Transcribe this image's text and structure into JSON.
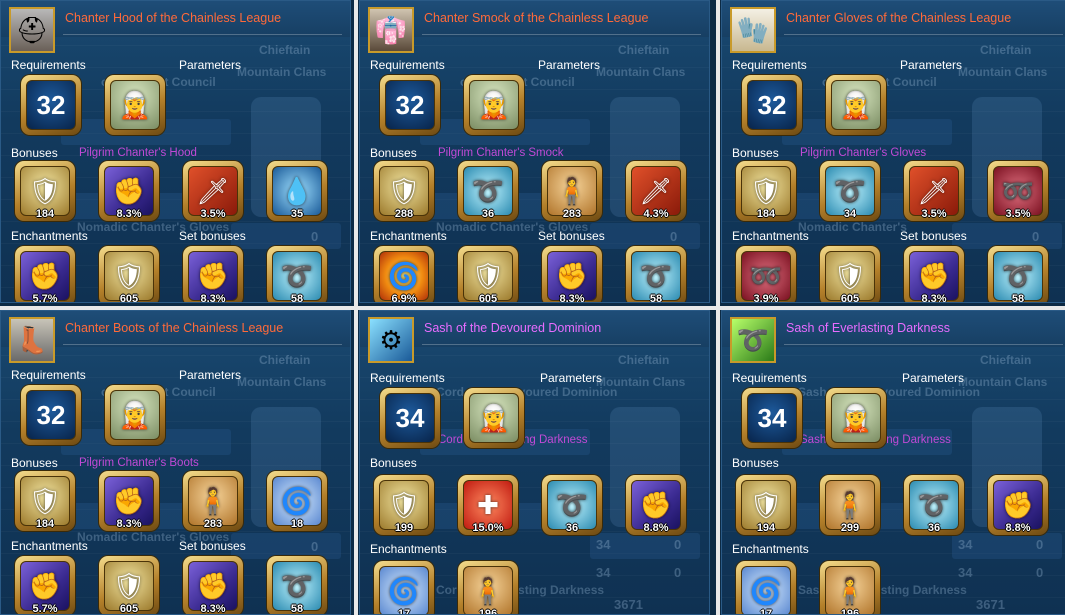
{
  "labels": {
    "requirements": "Requirements",
    "parameters": "Parameters",
    "bonuses": "Bonuses",
    "enchantments": "Enchantments",
    "set_bonuses": "Set bonuses"
  },
  "background": {
    "clan": "Mountain Clans",
    "chieftain": "Chieftain",
    "total": "3671",
    "count_34": "34",
    "count_0": "0"
  },
  "panels": [
    {
      "title": "Chanter Hood of the Chainless League",
      "title_color": "#ff6a3a",
      "item_icon": "hood-icon",
      "ghost_top": "of the Great Council",
      "subtitle": "Pilgrim Chanter's Hood",
      "ghost_mid": "Nomadic Chanter's Gloves",
      "level": "32",
      "bonuses": [
        {
          "icon": "hp-shield-icon",
          "value": "184"
        },
        {
          "icon": "crit-gauntlet-icon",
          "value": "8.3%"
        },
        {
          "icon": "attack-sword-icon",
          "value": "3.5%"
        },
        {
          "icon": "water-drop-icon",
          "value": "35"
        }
      ],
      "enchantments": [
        {
          "icon": "crit-gauntlet-icon",
          "value": "5.7%"
        },
        {
          "icon": "hp-shield-icon",
          "value": "605"
        },
        {
          "icon": "crit-gauntlet-icon",
          "value": "8.3%"
        },
        {
          "icon": "staff-icon",
          "value": "58"
        }
      ]
    },
    {
      "title": "Chanter Smock of the Chainless League",
      "title_color": "#ff6a3a",
      "item_icon": "smock-icon",
      "ghost_top": "of the Great Council",
      "subtitle": "Pilgrim Chanter's Smock",
      "ghost_mid": "Nomadic Chanter's Gloves",
      "level": "32",
      "bonuses": [
        {
          "icon": "hp-shield-icon",
          "value": "288"
        },
        {
          "icon": "staff-icon",
          "value": "36"
        },
        {
          "icon": "body-icon",
          "value": "283"
        },
        {
          "icon": "attack-sword-icon",
          "value": "4.3%"
        }
      ],
      "enchantments": [
        {
          "icon": "fire-swirl-icon",
          "value": "6.9%"
        },
        {
          "icon": "hp-shield-icon",
          "value": "605"
        },
        {
          "icon": "crit-gauntlet-icon",
          "value": "8.3%"
        },
        {
          "icon": "staff-icon",
          "value": "58"
        }
      ]
    },
    {
      "title": "Chanter Gloves of the Chainless League",
      "title_color": "#ff6a3a",
      "item_icon": "gloves-icon",
      "ghost_top": "of the Great Council",
      "subtitle": "Pilgrim Chanter's Gloves",
      "ghost_mid": "Nomadic Chanter's",
      "level": "32",
      "bonuses": [
        {
          "icon": "hp-shield-icon",
          "value": "184"
        },
        {
          "icon": "staff-icon",
          "value": "34"
        },
        {
          "icon": "attack-sword-icon",
          "value": "3.5%"
        },
        {
          "icon": "pink-hook-icon",
          "value": "3.5%"
        }
      ],
      "enchantments": [
        {
          "icon": "pink-hook-icon",
          "value": "3.9%"
        },
        {
          "icon": "hp-shield-icon",
          "value": "605"
        },
        {
          "icon": "crit-gauntlet-icon",
          "value": "8.3%"
        },
        {
          "icon": "staff-icon",
          "value": "58"
        }
      ]
    },
    {
      "title": "Chanter Boots of the Chainless League",
      "title_color": "#ff6a3a",
      "item_icon": "boots-icon",
      "ghost_top": "of the Great Council",
      "subtitle": "Pilgrim Chanter's Boots",
      "ghost_mid": "Nomadic Chanter's Gloves",
      "level": "32",
      "bonuses": [
        {
          "icon": "hp-shield-icon",
          "value": "184"
        },
        {
          "icon": "crit-gauntlet-icon",
          "value": "8.3%"
        },
        {
          "icon": "body-icon",
          "value": "283"
        },
        {
          "icon": "spiral-icon",
          "value": "18"
        }
      ],
      "enchantments": [
        {
          "icon": "crit-gauntlet-icon",
          "value": "5.7%"
        },
        {
          "icon": "hp-shield-icon",
          "value": "605"
        },
        {
          "icon": "crit-gauntlet-icon",
          "value": "8.3%"
        },
        {
          "icon": "staff-icon",
          "value": "58"
        }
      ]
    },
    {
      "title": "Sash of the Devoured Dominion",
      "title_color": "#e86cff",
      "item_icon": "sash-blue-icon",
      "ghost_top": "Cord of the Devoured Dominion",
      "subtitle": "Cord of Everlasting Darkness",
      "ghost_mid": "Cord of Everlasting Darkness",
      "level": "34",
      "bonuses": [
        {
          "icon": "hp-shield-icon",
          "value": "199"
        },
        {
          "icon": "heal-heart-icon",
          "value": "15.0%"
        },
        {
          "icon": "staff-icon",
          "value": "36"
        },
        {
          "icon": "crit-gauntlet-icon",
          "value": "8.8%"
        }
      ],
      "enchantments": [
        {
          "icon": "spiral-icon",
          "value": "17"
        },
        {
          "icon": "body-icon",
          "value": "196"
        }
      ]
    },
    {
      "title": "Sash of Everlasting Darkness",
      "title_color": "#e86cff",
      "item_icon": "sash-green-icon",
      "ghost_top": "Sash of the Devoured Dominion",
      "subtitle": "Sash of Everlasting Darkness",
      "ghost_mid": "Sash of Everlasting Darkness",
      "level": "34",
      "bonuses": [
        {
          "icon": "hp-shield-icon",
          "value": "194"
        },
        {
          "icon": "body-icon",
          "value": "299"
        },
        {
          "icon": "staff-icon",
          "value": "36"
        },
        {
          "icon": "crit-gauntlet-icon",
          "value": "8.8%"
        }
      ],
      "enchantments": [
        {
          "icon": "spiral-icon",
          "value": "17"
        },
        {
          "icon": "body-icon",
          "value": "196"
        }
      ]
    }
  ]
}
